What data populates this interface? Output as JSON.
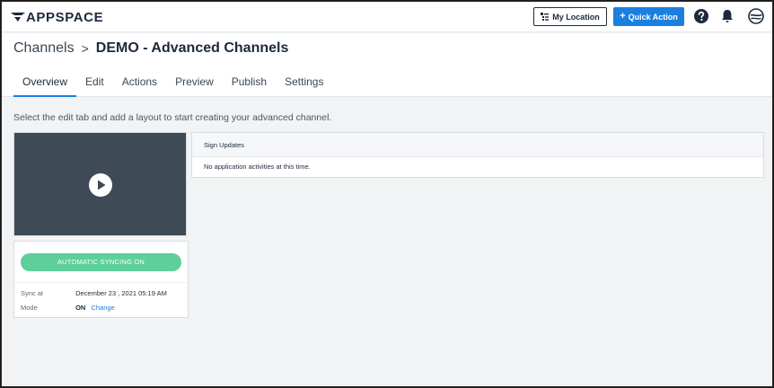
{
  "app": {
    "logo_text": "APPSPACE"
  },
  "header": {
    "my_location_label": "My Location",
    "quick_action_label": "Quick Action",
    "quick_action_icon": "plus-icon",
    "help_icon": "help-circle-icon",
    "notifications_icon": "bell-icon",
    "profile_icon": "profile-globe-icon",
    "accent_color": "#1b7fe0"
  },
  "breadcrumb": {
    "root": "Channels",
    "separator": ">",
    "current": "DEMO - Advanced Channels"
  },
  "tabs": [
    {
      "label": "Overview",
      "active": true
    },
    {
      "label": "Edit",
      "active": false
    },
    {
      "label": "Actions",
      "active": false
    },
    {
      "label": "Preview",
      "active": false
    },
    {
      "label": "Publish",
      "active": false
    },
    {
      "label": "Settings",
      "active": false
    }
  ],
  "main": {
    "intro_text": "Select the edit tab and add a layout to start creating your advanced channel."
  },
  "sync": {
    "button_label": "AUTOMATIC SYNCING ON",
    "button_color": "#5ecf99",
    "sync_at_label": "Sync at",
    "sync_at_value": "December 23 , 2021 05:19 AM",
    "mode_label": "Mode",
    "mode_value": "ON",
    "change_link": "Change"
  },
  "sign_updates": {
    "title": "Sign Updates",
    "message": "No application activities at this time."
  }
}
